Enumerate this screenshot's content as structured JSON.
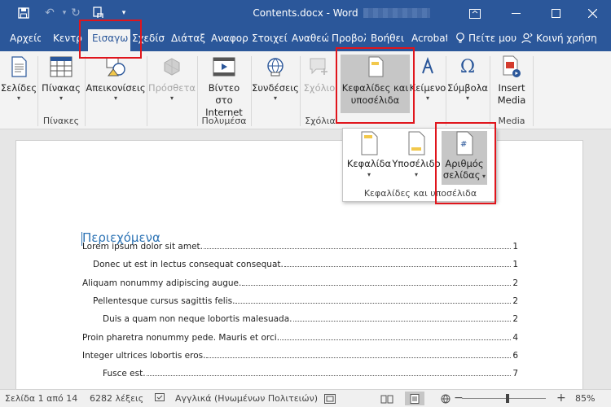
{
  "app": {
    "title": "Contents.docx  -  Word"
  },
  "quick_access": {
    "save_icon": "save-icon",
    "undo_icon": "undo-icon",
    "redo_icon": "redo-icon",
    "touch_icon": "touch-mode-icon",
    "customize_icon": "customize-icon"
  },
  "tabs": [
    "Αρχείο",
    "Κεντρ",
    "Εισαγω",
    "Σχεδίσ",
    "Διάταξ",
    "Αναφορ",
    "Στοιχεί",
    "Αναθεώ",
    "Προβολ",
    "Βοήθει",
    "Acrobat"
  ],
  "tabs_right": {
    "tell_me": "Πείτε μου",
    "share": "Κοινή χρήση"
  },
  "ribbon": {
    "pages": "Σελίδες",
    "table": "Πίνακας",
    "tables_group": "Πίνακες",
    "illustrations": "Απεικονίσεις",
    "addins": "Πρόσθετα",
    "video_line1": "Βίντεο στο",
    "video_line2": "Internet",
    "media_group": "Πολυμέσα",
    "links": "Συνδέσεις",
    "comment": "Σχόλιο",
    "comments_group": "Σχόλια",
    "header_footer_line1": "Κεφαλίδες και",
    "header_footer_line2": "υποσέλιδα",
    "text": "Κείμενο",
    "symbols": "Σύμβολα",
    "insert_media_line1": "Insert",
    "insert_media_line2": "Media",
    "media_group2": "Media"
  },
  "dropdown": {
    "header": "Κεφαλίδα",
    "footer": "Υποσέλιδο",
    "page_number_line1": "Αριθμός",
    "page_number_line2": "σελίδας",
    "group_label": "Κεφαλίδες και υποσέλιδα"
  },
  "document": {
    "toc_title": "Περιεχόμενα",
    "toc": [
      {
        "text": "Lorem ipsum dolor sit amet.",
        "page": "1",
        "level": 1
      },
      {
        "text": "Donec ut est in lectus consequat consequat.",
        "page": "1",
        "level": 2
      },
      {
        "text": "Aliquam nonummy adipiscing augue.",
        "page": "2",
        "level": 1
      },
      {
        "text": "Pellentesque cursus sagittis felis.",
        "page": "2",
        "level": 2
      },
      {
        "text": "Duis a quam non neque lobortis malesuada.",
        "page": "2",
        "level": 3
      },
      {
        "text": "Proin pharetra nonummy pede. Mauris et orci.",
        "page": "4",
        "level": 1
      },
      {
        "text": "Integer ultrices lobortis eros.",
        "page": "6",
        "level": 1
      },
      {
        "text": "Fusce est.",
        "page": "7",
        "level": 3
      }
    ]
  },
  "status": {
    "page": "Σελίδα 1 από 14",
    "words": "6282 λέξεις",
    "language": "Αγγλικά (Ηνωμένων Πολιτειών)",
    "zoom_out": "−",
    "zoom_in": "+",
    "zoom": "85%",
    "zoom_level_percent": 85
  },
  "colors": {
    "title_bar": "#2b579a",
    "ribbon": "#f3f3f3",
    "highlight": "#e0151c",
    "toc_title": "#2e74b5"
  }
}
